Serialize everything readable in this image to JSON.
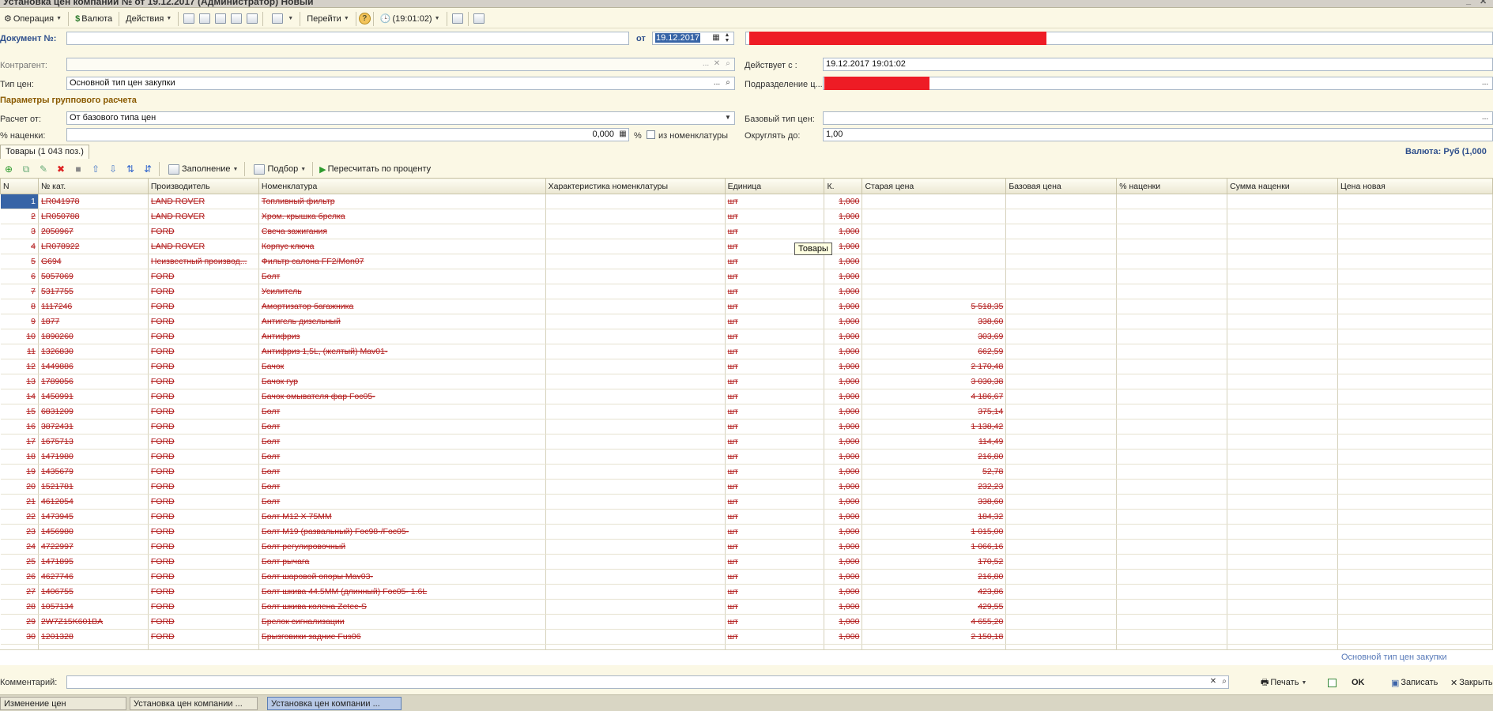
{
  "window": {
    "title": "Установка цен компании №  от 19.12.2017 (Администратор) Новый"
  },
  "toolbar": {
    "operation": "Операция",
    "currency": "Валюта",
    "actions": "Действия",
    "goto": "Перейти",
    "help": "?",
    "time": "(19:01:02)"
  },
  "header": {
    "doc_label": "Документ №:",
    "doc_number": "",
    "from_label": "от",
    "date": "19.12.2017",
    "counterparty_label": "Контрагент:",
    "counterparty": "",
    "valid_from_label": "Действует с :",
    "valid_from": "19.12.2017 19:01:02",
    "price_type_label": "Тип цен:",
    "price_type": "Основной тип цен закупки",
    "department_label": "Подразделение ц...",
    "group_section": "Параметры группового расчета",
    "calc_from_label": "Расчет от:",
    "calc_from": "От базового типа цен",
    "base_type_label": "Базовый тип цен:",
    "base_type": "",
    "markup_label": "% наценки:",
    "markup": "0,000",
    "percent_sign": "%",
    "from_nomenclature": "из номенклатуры",
    "round_label": "Округлять до:",
    "round": "1,00"
  },
  "tab": {
    "label": "Товары (1 043 поз.)"
  },
  "currency_right": "Валюта: Руб (1,000",
  "grid_toolbar": {
    "fill": "Заполнение",
    "select": "Подбор",
    "recalc": "Пересчитать по проценту"
  },
  "tooltip": "Товары",
  "columns": [
    "N",
    "№ кат.",
    "Производитель",
    "Номенклатура",
    "Характеристика номенклатуры",
    "Единица",
    "К.",
    "Старая цена",
    "Базовая цена",
    "% наценки",
    "Сумма наценки",
    "Цена новая"
  ],
  "rows": [
    [
      "1",
      "LR041978",
      "LAND ROVER",
      "Топливный фильтр",
      "",
      "шт",
      "1,000",
      ""
    ],
    [
      "2",
      "LR050788",
      "LAND ROVER",
      "Хром. крышка брелка",
      "",
      "шт",
      "1,000",
      ""
    ],
    [
      "3",
      "2050967",
      "FORD",
      "Свеча зажигания",
      "",
      "шт",
      "1,000",
      ""
    ],
    [
      "4",
      "LR078922",
      "LAND ROVER",
      "Корпус ключа",
      "",
      "шт",
      "1,000",
      ""
    ],
    [
      "5",
      "G694",
      "Неизвестный производ...",
      "Фильтр салона FF2/Mon07",
      "",
      "шт",
      "1,000",
      ""
    ],
    [
      "6",
      "5057069",
      "FORD",
      "Болт",
      "",
      "шт",
      "1,000",
      ""
    ],
    [
      "7",
      "5317755",
      "FORD",
      "Усилитель",
      "",
      "шт",
      "1,000",
      ""
    ],
    [
      "8",
      "1117246",
      "FORD",
      "Амортизатор багажника",
      "",
      "шт",
      "1,000",
      "5 518,35"
    ],
    [
      "9",
      "1877",
      "FORD",
      "Антигель дизельный",
      "",
      "шт",
      "1,000",
      "338,60"
    ],
    [
      "10",
      "1890260",
      "FORD",
      "Антифриз",
      "",
      "шт",
      "1,000",
      "303,69"
    ],
    [
      "11",
      "1326830",
      "FORD",
      "Антифриз 1,5L, (желтый) Mav01-",
      "",
      "шт",
      "1,000",
      "662,59"
    ],
    [
      "12",
      "1449886",
      "FORD",
      "Бачок",
      "",
      "шт",
      "1,000",
      "2 170,48"
    ],
    [
      "13",
      "1789056",
      "FORD",
      "Бачок гур",
      "",
      "шт",
      "1,000",
      "3 030,38"
    ],
    [
      "14",
      "1450991",
      "FORD",
      "Бачок омывателя фар Foc05-",
      "",
      "шт",
      "1,000",
      "4 186,67"
    ],
    [
      "15",
      "6831209",
      "FORD",
      "Болт",
      "",
      "шт",
      "1,000",
      "375,14"
    ],
    [
      "16",
      "3872431",
      "FORD",
      "Болт",
      "",
      "шт",
      "1,000",
      "1 138,42"
    ],
    [
      "17",
      "1675713",
      "FORD",
      "Болт",
      "",
      "шт",
      "1,000",
      "114,49"
    ],
    [
      "18",
      "1471980",
      "FORD",
      "Болт",
      "",
      "шт",
      "1,000",
      "216,80"
    ],
    [
      "19",
      "1435679",
      "FORD",
      "Болт",
      "",
      "шт",
      "1,000",
      "52,78"
    ],
    [
      "20",
      "1521781",
      "FORD",
      "Болт",
      "",
      "шт",
      "1,000",
      "232,23"
    ],
    [
      "21",
      "4612054",
      "FORD",
      "Болт",
      "",
      "шт",
      "1,000",
      "338,60"
    ],
    [
      "22",
      "1473945",
      "FORD",
      "Болт M12 X 75MM",
      "",
      "шт",
      "1,000",
      "184,32"
    ],
    [
      "23",
      "1456980",
      "FORD",
      "Болт M19 (развальный) Foc98-/Foc05-",
      "",
      "шт",
      "1,000",
      "1 015,00"
    ],
    [
      "24",
      "4722997",
      "FORD",
      "Болт регулировочный",
      "",
      "шт",
      "1,000",
      "1 066,16"
    ],
    [
      "25",
      "1471895",
      "FORD",
      "Болт рычага",
      "",
      "шт",
      "1,000",
      "170,52"
    ],
    [
      "26",
      "4627746",
      "FORD",
      "Болт шаровой опоры Mav03-",
      "",
      "шт",
      "1,000",
      "216,80"
    ],
    [
      "27",
      "1406755",
      "FORD",
      "Болт шкива 44.5MM (длинный) Foc05- 1.6L",
      "",
      "шт",
      "1,000",
      "423,86"
    ],
    [
      "28",
      "1057134",
      "FORD",
      "Болт шкива колена Zetec-S",
      "",
      "шт",
      "1,000",
      "429,55"
    ],
    [
      "29",
      "2W7Z15K601BA",
      "FORD",
      "Брелок сигнализации",
      "",
      "шт",
      "1,000",
      "4 655,20"
    ],
    [
      "30",
      "1201328",
      "FORD",
      "Брызговики задние Fus06",
      "",
      "шт",
      "1,000",
      "2 150,18"
    ]
  ],
  "footer_price_type": "Основной тип цен закупки",
  "footer": {
    "comment_label": "Комментарий:",
    "comment": "",
    "print": "Печать",
    "ok": "OK",
    "save": "Записать",
    "close": "Закрыть"
  },
  "taskbar": [
    "Изменение цен",
    "Установка цен компании ...",
    "Установка цен компании ..."
  ]
}
